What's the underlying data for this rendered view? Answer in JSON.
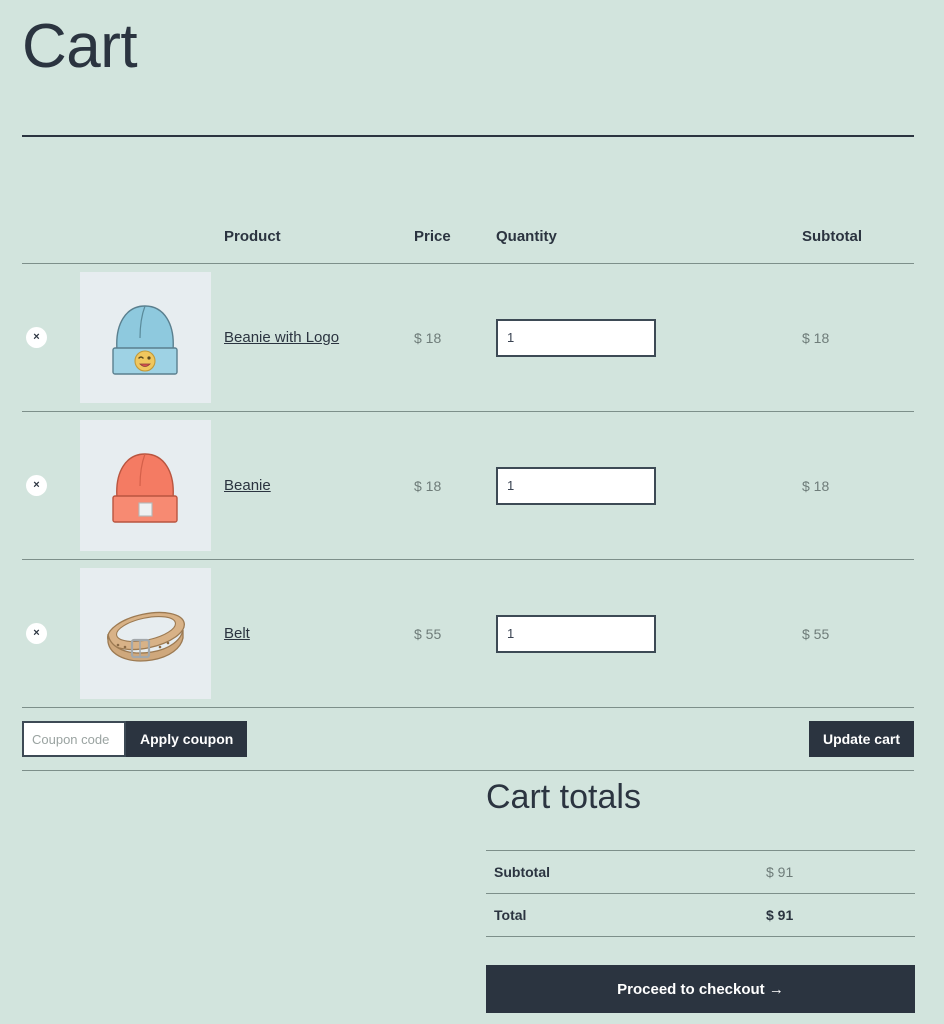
{
  "page": {
    "title": "Cart"
  },
  "table": {
    "headers": {
      "remove": "",
      "thumb": "",
      "product": "Product",
      "price": "Price",
      "quantity": "Quantity",
      "subtotal": "Subtotal"
    },
    "remove_label": "×",
    "rows": [
      {
        "name": "Beanie with Logo",
        "price": "$ 18",
        "quantity": "1",
        "subtotal": "$ 18",
        "image": "blue-beanie-with-emoji-logo"
      },
      {
        "name": "Beanie",
        "price": "$ 18",
        "quantity": "1",
        "subtotal": "$ 18",
        "image": "coral-beanie"
      },
      {
        "name": "Belt",
        "price": "$ 55",
        "quantity": "1",
        "subtotal": "$ 55",
        "image": "tan-leather-belt"
      }
    ]
  },
  "coupon": {
    "placeholder": "Coupon code",
    "value": "",
    "apply_label": "Apply coupon"
  },
  "update_cart_label": "Update cart",
  "totals": {
    "title": "Cart totals",
    "rows": [
      {
        "label": "Subtotal",
        "value": "$ 91"
      },
      {
        "label": "Total",
        "value": "$ 91"
      }
    ],
    "checkout_label": "Proceed to checkout  →"
  },
  "colors": {
    "background": "#d2e4dd",
    "ink": "#2b3440",
    "muted": "#6e7c79",
    "rule": "#7d8f8a",
    "thumb_bg": "#e7edf0",
    "button_bg": "#2b3440",
    "button_text": "#ffffff"
  }
}
